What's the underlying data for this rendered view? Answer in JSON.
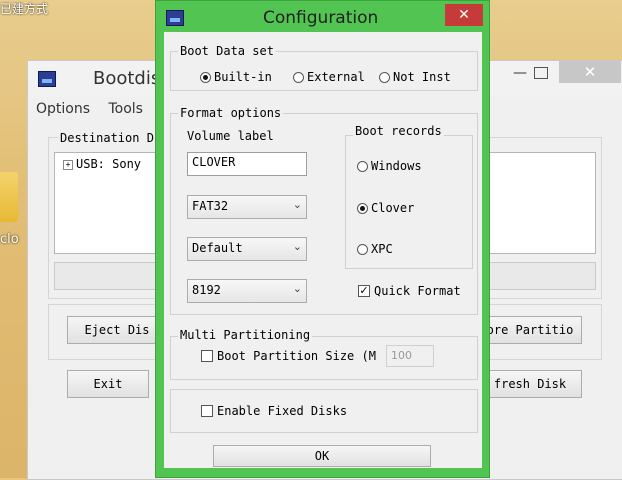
{
  "desktop": {
    "corner_text": "已建方式",
    "folder_label": "clo"
  },
  "bg_window": {
    "title": "Bootdis",
    "min_glyph": "—",
    "close_glyph": "✕",
    "menu": [
      "Options",
      "Tools"
    ],
    "group_label": "Destination D",
    "tree_item": "USB: Sony",
    "buttons": {
      "eject": "Eject Dis",
      "exit": "Exit",
      "restore": "ore Partitio",
      "refresh": "fresh Disk"
    }
  },
  "dialog": {
    "title": "Configuration",
    "close_glyph": "✕",
    "boot_data": {
      "label": "Boot Data set",
      "options": [
        "Built-in",
        "External",
        "Not Inst"
      ],
      "selected": 0
    },
    "format": {
      "label": "Format options",
      "volume_label_caption": "Volume label",
      "volume_label_value": "CLOVER",
      "fs": "FAT32",
      "alloc": "Default",
      "size": "8192"
    },
    "boot_records": {
      "label": "Boot records",
      "options": [
        "Windows",
        "Clover",
        "XPC"
      ],
      "selected": 1
    },
    "quick_format": {
      "label": "Quick Format",
      "checked": true
    },
    "multi": {
      "label": "Multi Partitioning",
      "boot_partition_label": "Boot Partition Size (M",
      "boot_partition_value": "100"
    },
    "fixed_disks": {
      "label": "Enable Fixed Disks"
    },
    "ok": "OK"
  }
}
